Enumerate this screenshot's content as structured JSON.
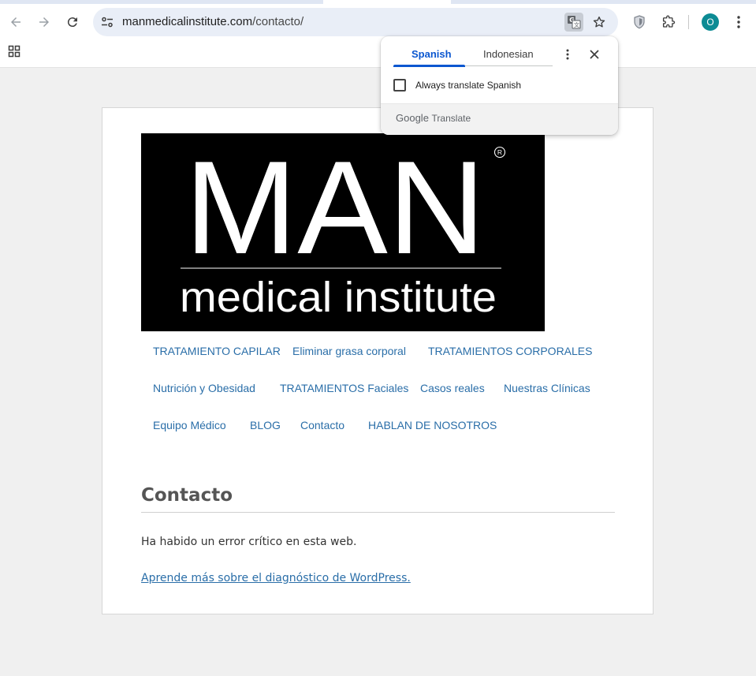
{
  "browser": {
    "url_domain": "manmedicalinstitute.com",
    "url_path": "/contacto/",
    "avatar_letter": "O",
    "accent_color": "#0b57d0",
    "avatar_color": "#0c8b94"
  },
  "icons": {
    "back": "arrow-left-icon",
    "forward": "arrow-right-icon",
    "reload": "reload-icon",
    "site_info": "tune-icon",
    "translate": "translate-icon",
    "bookmark": "star-icon",
    "shield": "shield-icon",
    "extensions": "puzzle-icon",
    "menu": "vertical-dots-icon",
    "apps": "grid-icon"
  },
  "site": {
    "logo": {
      "brand": "MAN",
      "subtitle": "medical institute",
      "registered": "R"
    },
    "menu": [
      [
        "TRATAMIENTO CAPILAR",
        "Eliminar grasa corporal",
        "TRATAMIENTOS CORPORALES"
      ],
      [
        "Nutrición y Obesidad",
        "TRATAMIENTOS Faciales",
        "Casos reales",
        "Nuestras Clínicas"
      ],
      [
        "Equipo Médico",
        "BLOG",
        "Contacto",
        "HABLAN DE NOSOTROS"
      ]
    ],
    "link_color": "#2a6ea8"
  },
  "entry": {
    "title": "Contacto",
    "message": "Ha habido un error crítico en esta web.",
    "link": "Aprende más sobre el diagnóstico de WordPress."
  },
  "translate_popup": {
    "tab_source": "Spanish",
    "tab_target": "Indonesian",
    "always_translate_label": "Always translate Spanish",
    "always_translate_checked": false,
    "brand_google": "Google",
    "brand_translate": "Translate"
  }
}
